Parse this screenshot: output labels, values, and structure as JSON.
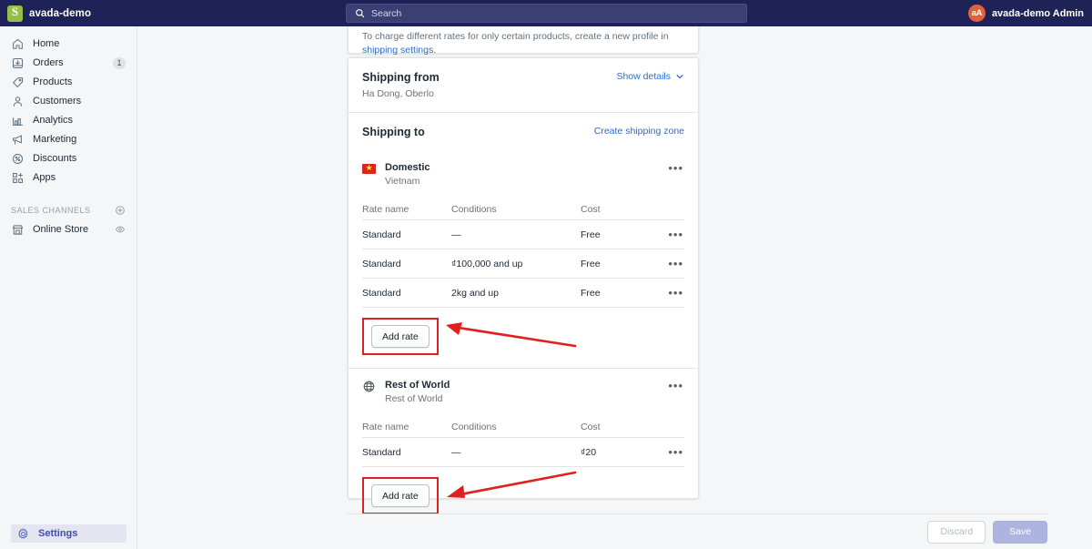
{
  "topbar": {
    "brand": "avada-demo",
    "brand_icon": "shopify-bag-icon",
    "search": {
      "placeholder": "Search",
      "icon": "search-icon"
    },
    "user": {
      "initials": "aA",
      "name": "avada-demo Admin",
      "avatar_color": "#e0613c"
    }
  },
  "sidebar": {
    "items": [
      {
        "label": "Home",
        "icon": "home-icon",
        "badge": ""
      },
      {
        "label": "Orders",
        "icon": "orders-icon",
        "badge": "1"
      },
      {
        "label": "Products",
        "icon": "tag-icon",
        "badge": ""
      },
      {
        "label": "Customers",
        "icon": "person-icon",
        "badge": ""
      },
      {
        "label": "Analytics",
        "icon": "bar-chart-icon",
        "badge": ""
      },
      {
        "label": "Marketing",
        "icon": "megaphone-icon",
        "badge": ""
      },
      {
        "label": "Discounts",
        "icon": "discount-icon",
        "badge": ""
      },
      {
        "label": "Apps",
        "icon": "apps-grid-icon",
        "badge": ""
      }
    ],
    "sales_channels": {
      "title": "SALES CHANNELS",
      "add_icon": "plus-circle-icon",
      "items": [
        {
          "label": "Online Store",
          "icon": "storefront-icon",
          "action_icon": "eye-icon"
        }
      ]
    },
    "settings": {
      "label": "Settings",
      "icon": "gear-icon",
      "active": true
    }
  },
  "notice": {
    "text_before": "To charge different rates for only certain products, create a new profile in ",
    "link": "shipping settings",
    "text_after": "."
  },
  "shipping_from": {
    "title": "Shipping from",
    "address": "Ha Dong, Oberlo",
    "details_link": "Show details",
    "chevron": "chevron-down-icon"
  },
  "shipping_to": {
    "title": "Shipping to",
    "create_link": "Create shipping zone"
  },
  "columns": {
    "rate_name": "Rate name",
    "conditions": "Conditions",
    "cost": "Cost"
  },
  "zones": [
    {
      "name": "Domestic",
      "sub": "Vietnam",
      "icon": "vietnam-flag-icon",
      "menu_icon": "ellipsis-icon",
      "rates": [
        {
          "name": "Standard",
          "conditions": "—",
          "cost": "Free"
        },
        {
          "name": "Standard",
          "conditions": "₫100,000 and up",
          "cost": "Free"
        },
        {
          "name": "Standard",
          "conditions": "2kg and up",
          "cost": "Free"
        }
      ],
      "add_rate": "Add rate"
    },
    {
      "name": "Rest of World",
      "sub": "Rest of World",
      "icon": "globe-icon",
      "menu_icon": "ellipsis-icon",
      "rates": [
        {
          "name": "Standard",
          "conditions": "—",
          "cost": "₫20"
        }
      ],
      "add_rate": "Add rate"
    }
  ],
  "footer": {
    "discard": "Discard",
    "save": "Save"
  },
  "annotations": {
    "highlight_color": "#e02020",
    "count": 2
  }
}
